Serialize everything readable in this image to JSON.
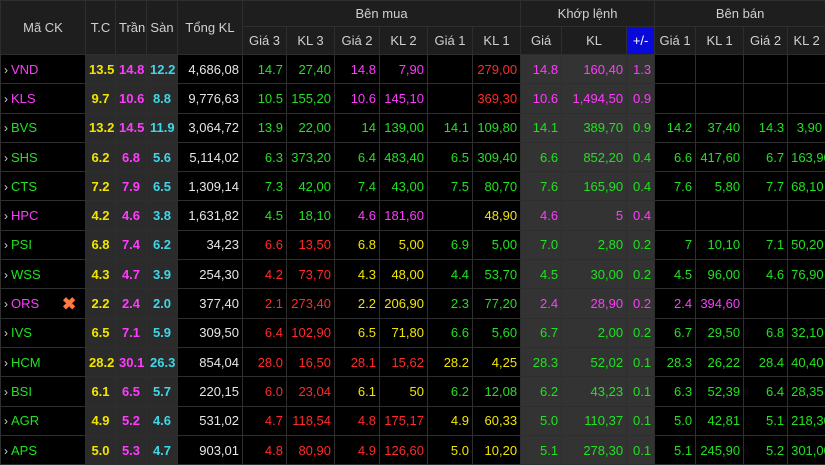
{
  "headers": {
    "symbol": "Mã CK",
    "ref": "T.C",
    "ceil": "Trần",
    "floor": "Sàn",
    "total_vol": "Tổng KL",
    "buy_group": "Bên mua",
    "match_group": "Khớp lệnh",
    "sell_group": "Bên bán",
    "buy_cols": [
      "Giá 3",
      "KL 3",
      "Giá 2",
      "KL 2",
      "Giá 1",
      "KL 1"
    ],
    "match_cols": [
      "Giá",
      "KL",
      "+/-"
    ],
    "sell_cols": [
      "Giá 1",
      "KL 1",
      "Giá 2",
      "KL 2"
    ]
  },
  "colors": {
    "ref": "#f2e600",
    "ceil": "#ff3bff",
    "floor": "#3fd7e8",
    "up": "#21e121",
    "down": "#ff2a2a",
    "pct_header": "#0a0ad8"
  },
  "rows": [
    {
      "sym": "VND",
      "cls": "ceil",
      "ref": "13.5",
      "ceil": "14.8",
      "floor": "12.2",
      "total": "4,686,08",
      "b3p": "14.7",
      "b3v": "27,40",
      "b3c": "up",
      "b2p": "14.8",
      "b2v": "7,90",
      "b2c": "ceil",
      "b1p": "",
      "b1v": "279,00",
      "b1c": "down",
      "mp": "14.8",
      "mv": "160,40",
      "mc": "ceil",
      "chg": "1.3",
      "chgc": "ceil",
      "s1p": "",
      "s1v": "",
      "s1c": "up",
      "s2p": "",
      "s2v": "",
      "s2c": "up"
    },
    {
      "sym": "KLS",
      "cls": "ceil",
      "ref": "9.7",
      "ceil": "10.6",
      "floor": "8.8",
      "total": "9,776,63",
      "b3p": "10.5",
      "b3v": "155,20",
      "b3c": "up",
      "b2p": "10.6",
      "b2v": "145,10",
      "b2c": "ceil",
      "b1p": "",
      "b1v": "369,30",
      "b1c": "down",
      "mp": "10.6",
      "mv": "1,494,50",
      "mc": "ceil",
      "chg": "0.9",
      "chgc": "ceil",
      "s1p": "",
      "s1v": "",
      "s1c": "up",
      "s2p": "",
      "s2v": "",
      "s2c": "up"
    },
    {
      "sym": "BVS",
      "cls": "up",
      "ref": "13.2",
      "ceil": "14.5",
      "floor": "11.9",
      "total": "3,064,72",
      "b3p": "13.9",
      "b3v": "22,00",
      "b3c": "up",
      "b2p": "14",
      "b2v": "139,00",
      "b2c": "up",
      "b1p": "14.1",
      "b1v": "109,80",
      "b1c": "up",
      "mp": "14.1",
      "mv": "389,70",
      "mc": "up",
      "chg": "0.9",
      "chgc": "up",
      "s1p": "14.2",
      "s1v": "37,40",
      "s1c": "up",
      "s2p": "14.3",
      "s2v": "3,90",
      "s2c": "up"
    },
    {
      "sym": "SHS",
      "cls": "up",
      "ref": "6.2",
      "ceil": "6.8",
      "floor": "5.6",
      "total": "5,114,02",
      "b3p": "6.3",
      "b3v": "373,20",
      "b3c": "up",
      "b2p": "6.4",
      "b2v": "483,40",
      "b2c": "up",
      "b1p": "6.5",
      "b1v": "309,40",
      "b1c": "up",
      "mp": "6.6",
      "mv": "852,20",
      "mc": "up",
      "chg": "0.4",
      "chgc": "up",
      "s1p": "6.6",
      "s1v": "417,60",
      "s1c": "up",
      "s2p": "6.7",
      "s2v": "163,90",
      "s2c": "up"
    },
    {
      "sym": "CTS",
      "cls": "up",
      "ref": "7.2",
      "ceil": "7.9",
      "floor": "6.5",
      "total": "1,309,14",
      "b3p": "7.3",
      "b3v": "42,00",
      "b3c": "up",
      "b2p": "7.4",
      "b2v": "43,00",
      "b2c": "up",
      "b1p": "7.5",
      "b1v": "80,70",
      "b1c": "up",
      "mp": "7.6",
      "mv": "165,90",
      "mc": "up",
      "chg": "0.4",
      "chgc": "up",
      "s1p": "7.6",
      "s1v": "5,80",
      "s1c": "up",
      "s2p": "7.7",
      "s2v": "68,10",
      "s2c": "up"
    },
    {
      "sym": "HPC",
      "cls": "ceil",
      "ref": "4.2",
      "ceil": "4.6",
      "floor": "3.8",
      "total": "1,631,82",
      "b3p": "4.5",
      "b3v": "18,10",
      "b3c": "up",
      "b2p": "4.6",
      "b2v": "181,60",
      "b2c": "ceil",
      "b1p": "",
      "b1v": "48,90",
      "b1c": "ref",
      "mp": "4.6",
      "mv": "5",
      "mc": "ceil",
      "chg": "0.4",
      "chgc": "ceil",
      "s1p": "",
      "s1v": "",
      "s1c": "up",
      "s2p": "",
      "s2v": "",
      "s2c": "up"
    },
    {
      "sym": "PSI",
      "cls": "up",
      "ref": "6.8",
      "ceil": "7.4",
      "floor": "6.2",
      "total": "34,23",
      "b3p": "6.6",
      "b3v": "13,50",
      "b3c": "down",
      "b2p": "6.8",
      "b2v": "5,00",
      "b2c": "ref",
      "b1p": "6.9",
      "b1v": "5,00",
      "b1c": "up",
      "mp": "7.0",
      "mv": "2,80",
      "mc": "up",
      "chg": "0.2",
      "chgc": "up",
      "s1p": "7",
      "s1v": "10,10",
      "s1c": "up",
      "s2p": "7.1",
      "s2v": "50,20",
      "s2c": "up"
    },
    {
      "sym": "WSS",
      "cls": "up",
      "ref": "4.3",
      "ceil": "4.7",
      "floor": "3.9",
      "total": "254,30",
      "b3p": "4.2",
      "b3v": "73,70",
      "b3c": "down",
      "b2p": "4.3",
      "b2v": "48,00",
      "b2c": "ref",
      "b1p": "4.4",
      "b1v": "53,70",
      "b1c": "up",
      "mp": "4.5",
      "mv": "30,00",
      "mc": "up",
      "chg": "0.2",
      "chgc": "up",
      "s1p": "4.5",
      "s1v": "96,00",
      "s1c": "up",
      "s2p": "4.6",
      "s2v": "76,90",
      "s2c": "up"
    },
    {
      "sym": "ORS",
      "cls": "ceil",
      "ref": "2.2",
      "ceil": "2.4",
      "floor": "2.0",
      "total": "377,40",
      "mark": "✖",
      "b3p": "2.1",
      "b3v": "273,40",
      "b3c": "down",
      "b2p": "2.2",
      "b2v": "206,90",
      "b2c": "ref",
      "b1p": "2.3",
      "b1v": "77,20",
      "b1c": "up",
      "mp": "2.4",
      "mv": "28,90",
      "mc": "ceil",
      "chg": "0.2",
      "chgc": "ceil",
      "s1p": "2.4",
      "s1v": "394,60",
      "s1c": "ceil",
      "s2p": "",
      "s2v": "",
      "s2c": "up"
    },
    {
      "sym": "IVS",
      "cls": "up",
      "ref": "6.5",
      "ceil": "7.1",
      "floor": "5.9",
      "total": "309,50",
      "b3p": "6.4",
      "b3v": "102,90",
      "b3c": "down",
      "b2p": "6.5",
      "b2v": "71,80",
      "b2c": "ref",
      "b1p": "6.6",
      "b1v": "5,60",
      "b1c": "up",
      "mp": "6.7",
      "mv": "2,00",
      "mc": "up",
      "chg": "0.2",
      "chgc": "up",
      "s1p": "6.7",
      "s1v": "29,50",
      "s1c": "up",
      "s2p": "6.8",
      "s2v": "32,10",
      "s2c": "up"
    },
    {
      "sym": "HCM",
      "cls": "up",
      "ref": "28.2",
      "ceil": "30.1",
      "floor": "26.3",
      "total": "854,04",
      "b3p": "28.0",
      "b3v": "16,50",
      "b3c": "down",
      "b2p": "28.1",
      "b2v": "15,62",
      "b2c": "down",
      "b1p": "28.2",
      "b1v": "4,25",
      "b1c": "ref",
      "mp": "28.3",
      "mv": "52,02",
      "mc": "up",
      "chg": "0.1",
      "chgc": "up",
      "s1p": "28.3",
      "s1v": "26,22",
      "s1c": "up",
      "s2p": "28.4",
      "s2v": "40,40",
      "s2c": "up"
    },
    {
      "sym": "BSI",
      "cls": "up",
      "ref": "6.1",
      "ceil": "6.5",
      "floor": "5.7",
      "total": "220,15",
      "b3p": "6.0",
      "b3v": "23,04",
      "b3c": "down",
      "b2p": "6.1",
      "b2v": "50",
      "b2c": "ref",
      "b1p": "6.2",
      "b1v": "12,08",
      "b1c": "up",
      "mp": "6.2",
      "mv": "43,23",
      "mc": "up",
      "chg": "0.1",
      "chgc": "up",
      "s1p": "6.3",
      "s1v": "52,39",
      "s1c": "up",
      "s2p": "6.4",
      "s2v": "28,35",
      "s2c": "up"
    },
    {
      "sym": "AGR",
      "cls": "up",
      "ref": "4.9",
      "ceil": "5.2",
      "floor": "4.6",
      "total": "531,02",
      "b3p": "4.7",
      "b3v": "118,54",
      "b3c": "down",
      "b2p": "4.8",
      "b2v": "175,17",
      "b2c": "down",
      "b1p": "4.9",
      "b1v": "60,33",
      "b1c": "ref",
      "mp": "5.0",
      "mv": "110,37",
      "mc": "up",
      "chg": "0.1",
      "chgc": "up",
      "s1p": "5.0",
      "s1v": "42,81",
      "s1c": "up",
      "s2p": "5.1",
      "s2v": "218,30",
      "s2c": "up"
    },
    {
      "sym": "APS",
      "cls": "up",
      "ref": "5.0",
      "ceil": "5.3",
      "floor": "4.7",
      "total": "903,01",
      "b3p": "4.8",
      "b3v": "80,90",
      "b3c": "down",
      "b2p": "4.9",
      "b2v": "126,60",
      "b2c": "down",
      "b1p": "5.0",
      "b1v": "10,20",
      "b1c": "ref",
      "mp": "5.1",
      "mv": "278,30",
      "mc": "up",
      "chg": "0.1",
      "chgc": "up",
      "s1p": "5.1",
      "s1v": "245,90",
      "s1c": "up",
      "s2p": "5.2",
      "s2v": "301,00",
      "s2c": "up"
    }
  ]
}
